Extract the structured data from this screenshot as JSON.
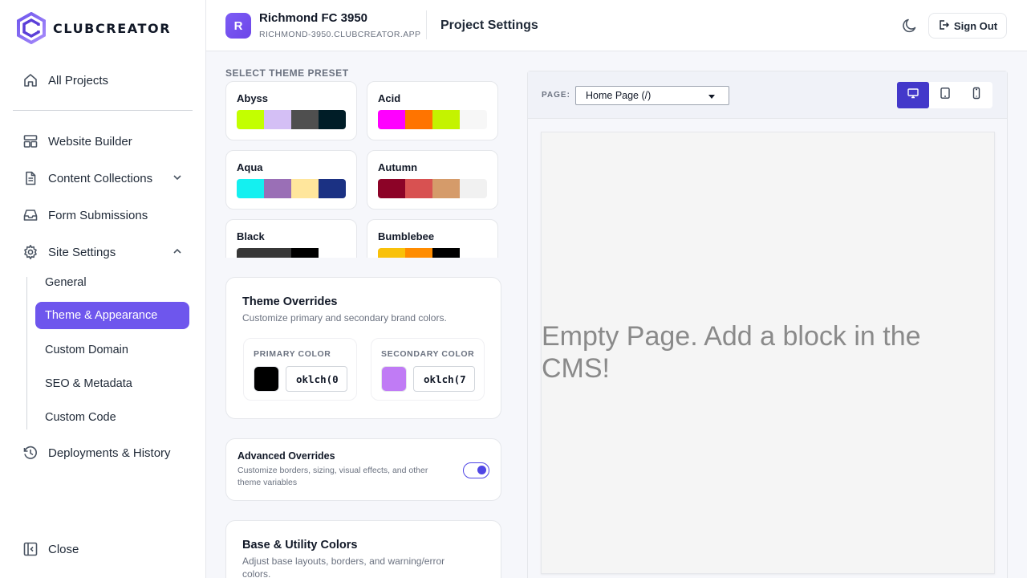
{
  "brand": {
    "name": "CLUBCREATOR",
    "accent": "#6e56ed"
  },
  "sidebar": {
    "nav": [
      {
        "label": "All Projects",
        "icon": "home-icon"
      },
      {
        "label": "Website Builder",
        "icon": "layout-icon"
      },
      {
        "label": "Content Collections",
        "icon": "document-icon"
      },
      {
        "label": "Form Submissions",
        "icon": "inbox-icon"
      },
      {
        "label": "Site Settings",
        "icon": "gear-icon"
      },
      {
        "label": "Deployments & History",
        "icon": "history-icon"
      }
    ],
    "settings_sub": [
      {
        "label": "General"
      },
      {
        "label": "Theme & Appearance",
        "active": true
      },
      {
        "label": "Custom Domain"
      },
      {
        "label": "SEO & Metadata"
      },
      {
        "label": "Custom Code"
      }
    ],
    "close_label": "Close"
  },
  "header": {
    "avatar_letter": "R",
    "project_name": "Richmond FC 3950",
    "project_domain": "RICHMOND-3950.CLUBCREATOR.APP",
    "page_title": "Project Settings",
    "sign_out": "Sign Out"
  },
  "presets": {
    "heading": "SELECT THEME PRESET",
    "items": [
      {
        "name": "Abyss",
        "colors": [
          "#c3ff00",
          "#d4bff5",
          "#4f4f4f",
          "#001d27"
        ]
      },
      {
        "name": "Acid",
        "colors": [
          "#ff00ff",
          "#ff7400",
          "#c4f300",
          "#f7f7f7"
        ]
      },
      {
        "name": "Aqua",
        "colors": [
          "#14f0f0",
          "#9a6fb6",
          "#ffe69c",
          "#1b3183"
        ]
      },
      {
        "name": "Autumn",
        "colors": [
          "#8c0327",
          "#d85151",
          "#d59b6a",
          "#f1f1f1"
        ]
      },
      {
        "name": "Black",
        "colors": [
          "#373737",
          "#373737",
          "#000000",
          "#ffffff"
        ]
      },
      {
        "name": "Bumblebee",
        "colors": [
          "#f9c10a",
          "#ff8c00",
          "#000000",
          "#ffffff"
        ]
      }
    ]
  },
  "overrides": {
    "title": "Theme Overrides",
    "subtitle": "Customize primary and secondary brand colors.",
    "primary": {
      "label": "PRIMARY COLOR",
      "value": "oklch(0",
      "swatch": "#000000"
    },
    "secondary": {
      "label": "SECONDARY COLOR",
      "value": "oklch(7",
      "swatch": "#c07bf5"
    }
  },
  "advanced": {
    "title": "Advanced Overrides",
    "description": "Customize borders, sizing, visual effects, and other theme variables",
    "enabled": true
  },
  "base_colors": {
    "title": "Base & Utility Colors",
    "subtitle": "Adjust base layouts, borders, and warning/error colors."
  },
  "preview": {
    "page_label": "PAGE:",
    "page_value": "Home Page (/)",
    "device_active": "desktop",
    "empty_message": "Empty Page. Add a block in the CMS!"
  }
}
